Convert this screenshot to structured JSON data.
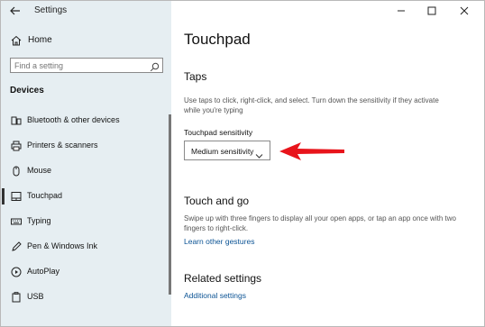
{
  "window": {
    "title": "Settings",
    "controls": [
      "minimize",
      "maximize",
      "close"
    ]
  },
  "sidebar": {
    "home_label": "Home",
    "search_placeholder": "Find a setting",
    "section_title": "Devices",
    "items": [
      {
        "label": "Bluetooth & other devices",
        "icon": "bluetooth-icon",
        "selected": false
      },
      {
        "label": "Printers & scanners",
        "icon": "printer-icon",
        "selected": false
      },
      {
        "label": "Mouse",
        "icon": "mouse-icon",
        "selected": false
      },
      {
        "label": "Touchpad",
        "icon": "touchpad-icon",
        "selected": true
      },
      {
        "label": "Typing",
        "icon": "keyboard-icon",
        "selected": false
      },
      {
        "label": "Pen & Windows Ink",
        "icon": "pen-icon",
        "selected": false
      },
      {
        "label": "AutoPlay",
        "icon": "autoplay-icon",
        "selected": false
      },
      {
        "label": "USB",
        "icon": "usb-icon",
        "selected": false
      }
    ]
  },
  "main": {
    "title": "Touchpad",
    "taps": {
      "heading": "Taps",
      "description": "Use taps to click, right-click, and select. Turn down the sensitivity if they activate while you're typing",
      "sensitivity_label": "Touchpad sensitivity",
      "sensitivity_value": "Medium sensitivity"
    },
    "touch_and_go": {
      "heading": "Touch and go",
      "description": "Swipe up with three fingers to display all your open apps, or tap an app once with two fingers to right-click.",
      "link": "Learn other gestures"
    },
    "related": {
      "heading": "Related settings",
      "link": "Additional settings"
    }
  },
  "colors": {
    "sidebar_bg": "#e6eef2",
    "link": "#0b5394",
    "annotation_arrow": "#e8141b"
  }
}
